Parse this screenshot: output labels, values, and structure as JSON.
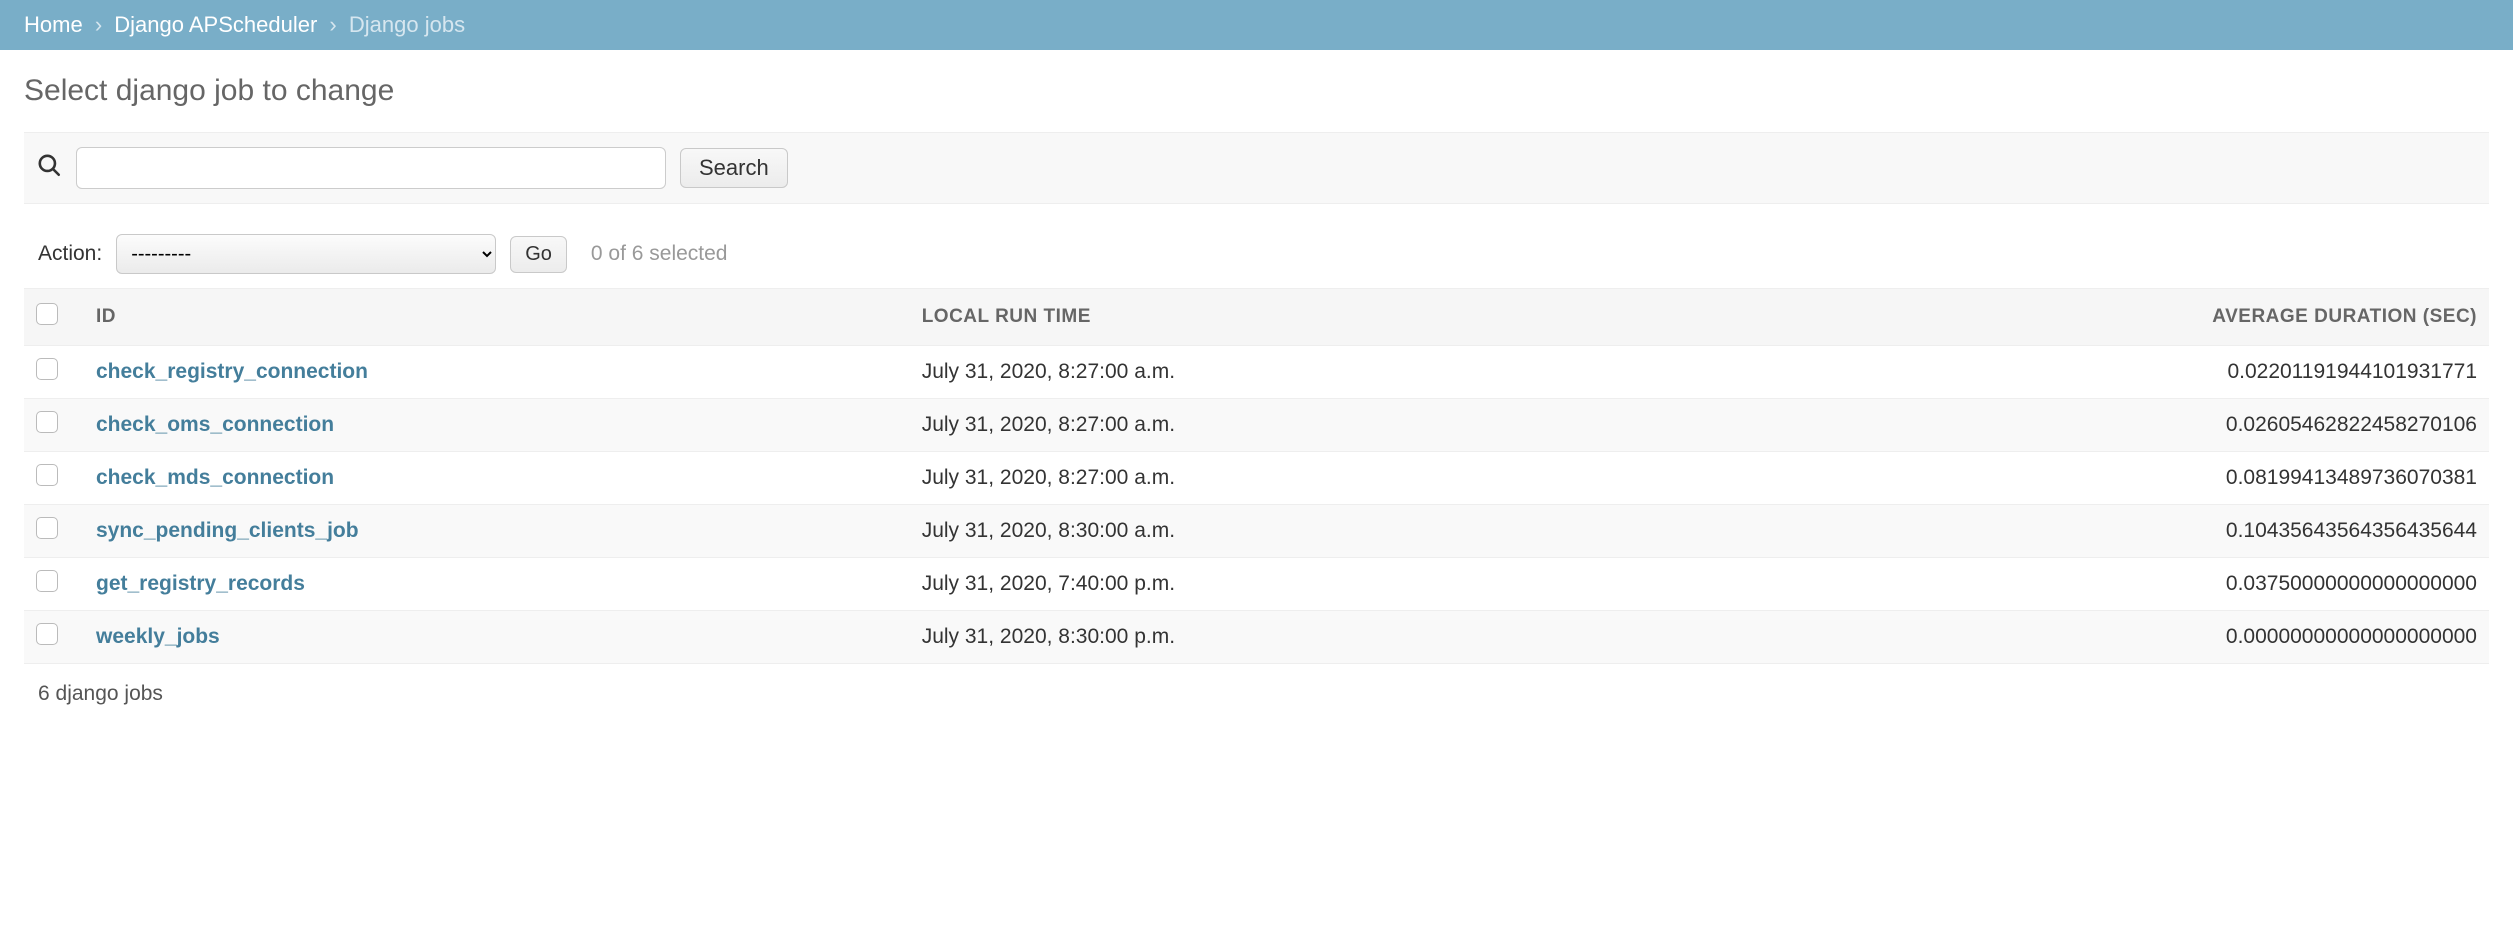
{
  "breadcrumbs": {
    "home": "Home",
    "app": "Django APScheduler",
    "current": "Django jobs"
  },
  "page_title": "Select django job to change",
  "search": {
    "placeholder": "",
    "button": "Search"
  },
  "actions": {
    "label": "Action:",
    "placeholder": "---------",
    "go": "Go",
    "selection_count": "0 of 6 selected"
  },
  "columns": {
    "id": "ID",
    "local_run_time": "LOCAL RUN TIME",
    "avg_duration": "AVERAGE DURATION (SEC)"
  },
  "rows": [
    {
      "id": "check_registry_connection",
      "local_run_time": "July 31, 2020, 8:27:00 a.m.",
      "avg_duration": "0.02201191944101931771"
    },
    {
      "id": "check_oms_connection",
      "local_run_time": "July 31, 2020, 8:27:00 a.m.",
      "avg_duration": "0.02605462822458270106"
    },
    {
      "id": "check_mds_connection",
      "local_run_time": "July 31, 2020, 8:27:00 a.m.",
      "avg_duration": "0.08199413489736070381"
    },
    {
      "id": "sync_pending_clients_job",
      "local_run_time": "July 31, 2020, 8:30:00 a.m.",
      "avg_duration": "0.10435643564356435644"
    },
    {
      "id": "get_registry_records",
      "local_run_time": "July 31, 2020, 7:40:00 p.m.",
      "avg_duration": "0.03750000000000000000"
    },
    {
      "id": "weekly_jobs",
      "local_run_time": "July 31, 2020, 8:30:00 p.m.",
      "avg_duration": "0.00000000000000000000"
    }
  ],
  "paginator": "6 django jobs"
}
